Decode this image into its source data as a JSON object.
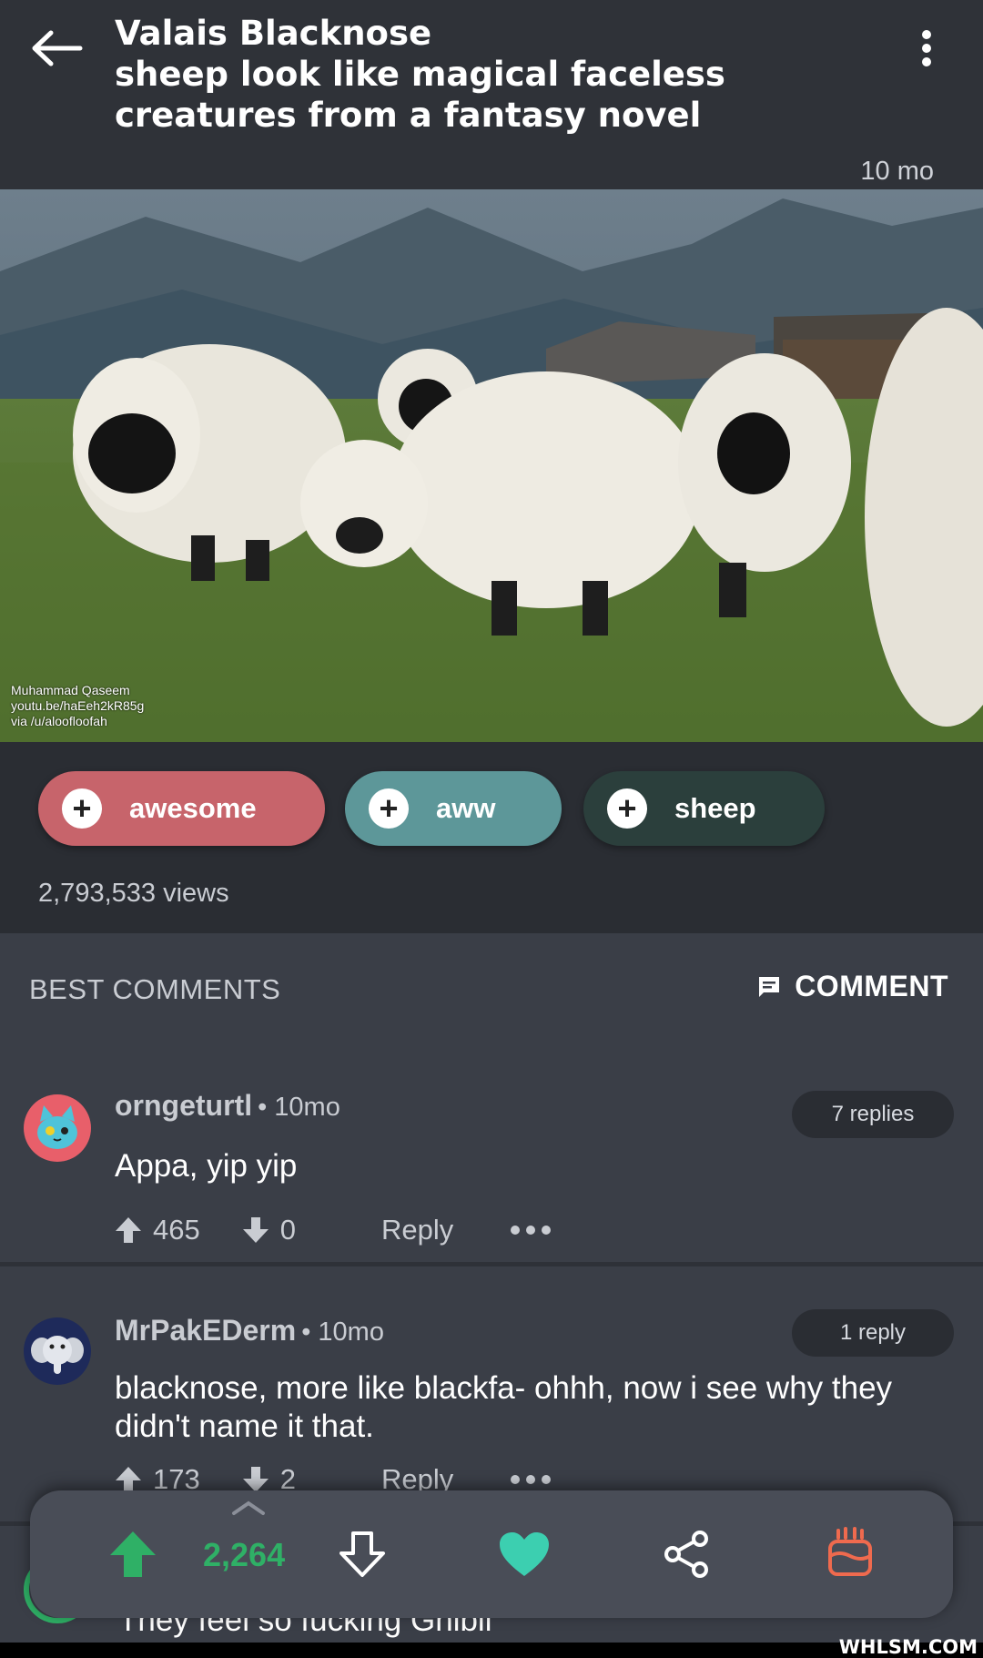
{
  "post": {
    "title": "Valais Blacknose\n sheep look like magical faceless creatures from a fantasy novel",
    "age": "10 mo",
    "credit": "Muhammad Qaseem\nyoutu.be/haEeh2kR85g\nvia /u/aloofloofah",
    "views": "2,793,533 views"
  },
  "tags": [
    {
      "label": "awesome",
      "color": "#c7646b"
    },
    {
      "label": "aww",
      "color": "#5d9799"
    },
    {
      "label": "sheep",
      "color": "#2b3f3c"
    }
  ],
  "comments_section": {
    "title": "BEST COMMENTS",
    "comment_button": "COMMENT"
  },
  "comments": [
    {
      "user": "orngeturtl",
      "time": "• 10mo",
      "replies": "7 replies",
      "text": "Appa, yip yip",
      "upvotes": "465",
      "downvotes": "0",
      "reply_label": "Reply"
    },
    {
      "user": "MrPakEDerm",
      "time": "• 10mo",
      "replies": "1 reply",
      "text": "blacknose, more like blackfa- ohhh, now i see why they didn't name it that.",
      "upvotes": "173",
      "downvotes": "2",
      "reply_label": "Reply"
    }
  ],
  "peek_comment": {
    "text": "They feel so fucking Ghibli"
  },
  "bottom_bar": {
    "score": "2,264",
    "upvote_color": "#2fb066",
    "heart_color": "#3ccfb0",
    "gift_color": "#ef6a4e"
  },
  "watermark": "WHLSM.COM"
}
